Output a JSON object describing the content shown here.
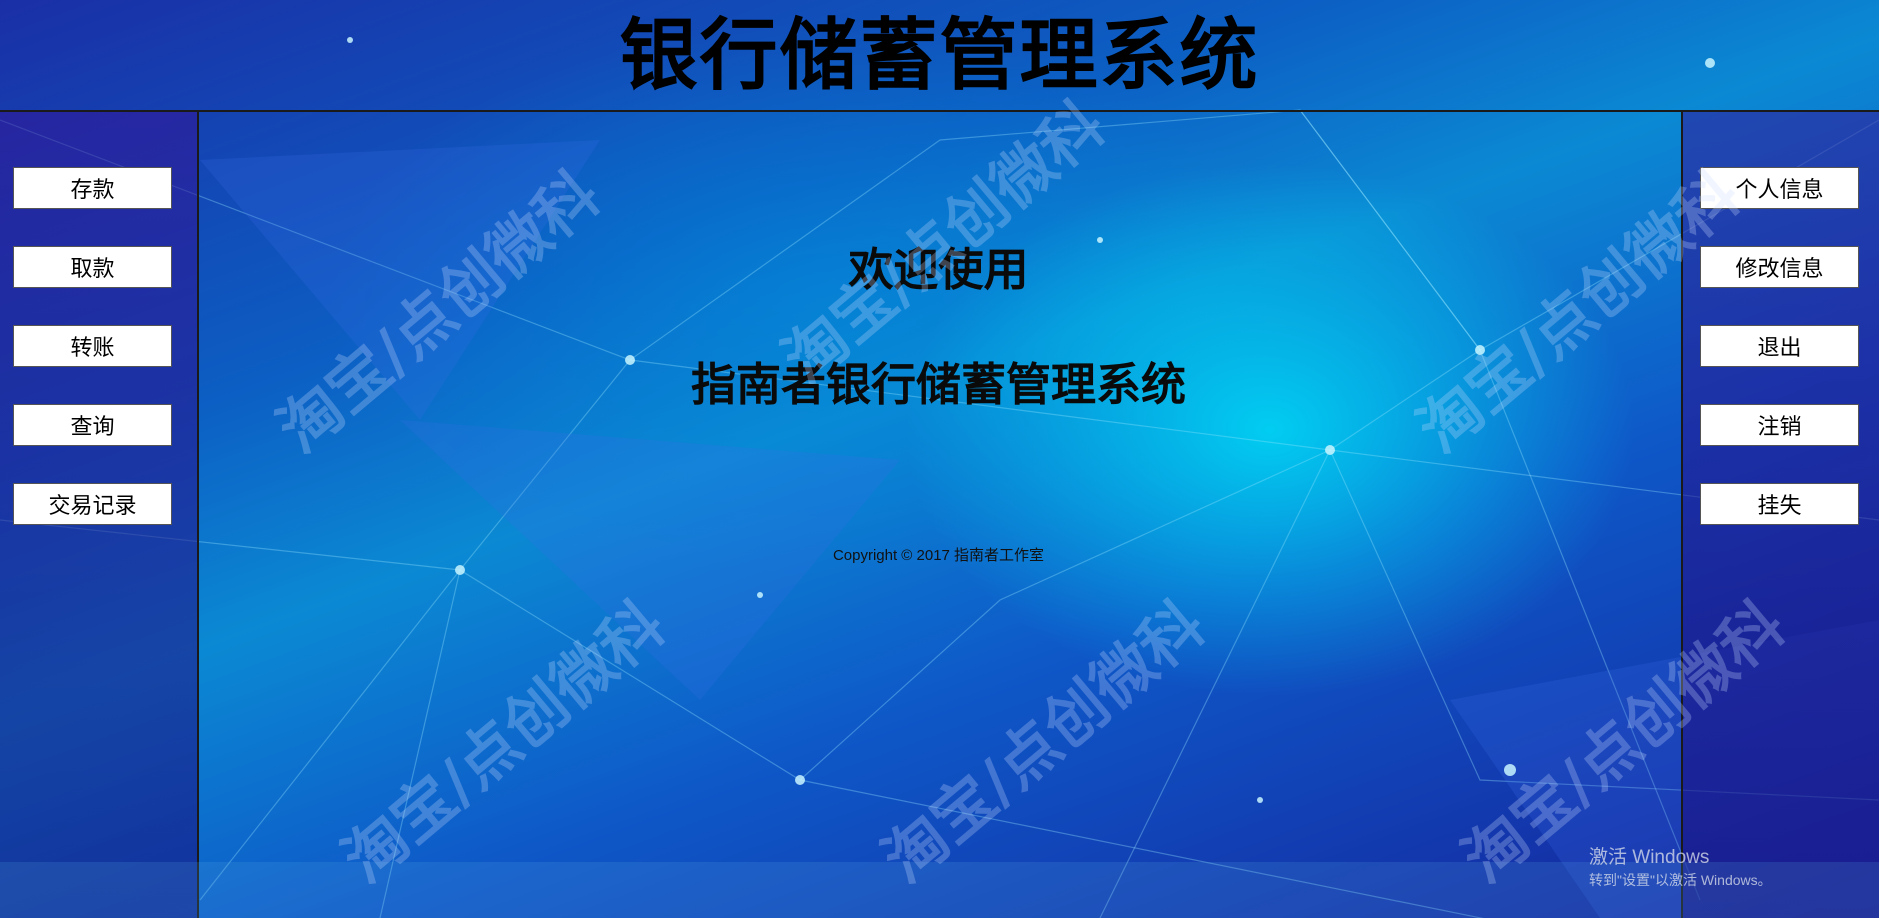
{
  "header": {
    "title": "银行储蓄管理系统"
  },
  "left_menu": [
    {
      "label": "存款"
    },
    {
      "label": "取款"
    },
    {
      "label": "转账"
    },
    {
      "label": "查询"
    },
    {
      "label": "交易记录"
    }
  ],
  "right_menu": [
    {
      "label": "个人信息"
    },
    {
      "label": "修改信息"
    },
    {
      "label": "退出"
    },
    {
      "label": "注销"
    },
    {
      "label": "挂失"
    }
  ],
  "main": {
    "welcome_line1": "欢迎使用",
    "welcome_line2": "指南者银行储蓄管理系统",
    "copyright": "Copyright © 2017 指南者工作室"
  },
  "watermark": {
    "text": "淘宝/点创微科"
  },
  "os_overlay": {
    "title": "激活 Windows",
    "subtitle": "转到\"设置\"以激活 Windows。"
  },
  "colors": {
    "background_cyan": "#00d7f5",
    "background_blue": "#0c5fc4",
    "background_indigo": "#16219a",
    "button_bg": "#ffffff",
    "text": "#000000"
  }
}
